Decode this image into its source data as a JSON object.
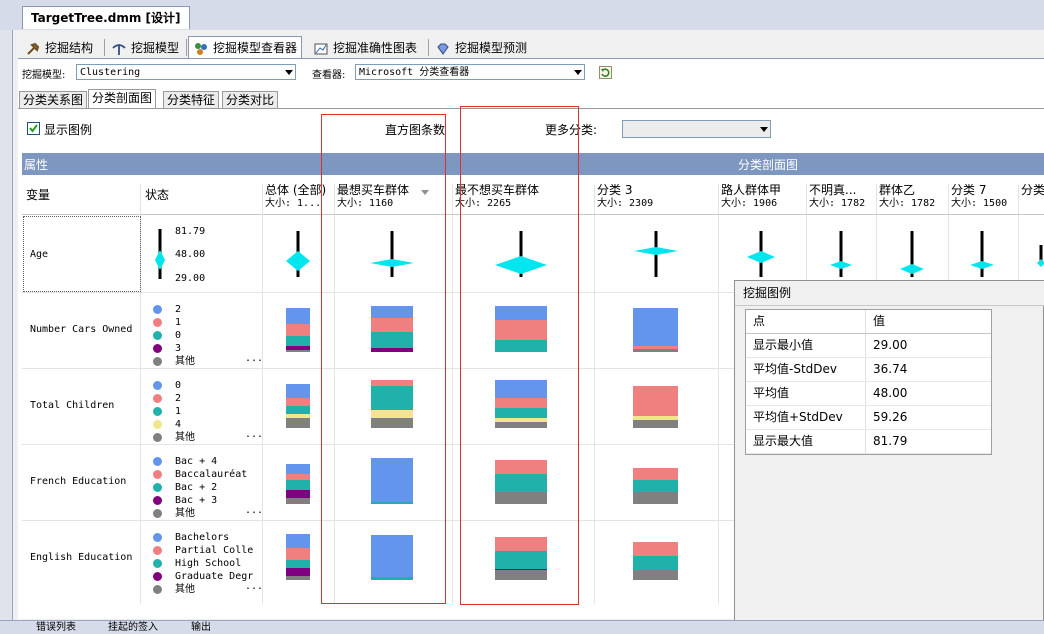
{
  "doc_tab": "TargetTree.dmm [设计]",
  "designer_tabs": [
    "挖掘结构",
    "挖掘模型",
    "挖掘模型查看器",
    "挖掘准确性图表",
    "挖掘模型预测"
  ],
  "model_label": "挖掘模型:",
  "model_value": "Clustering",
  "viewer_label": "查看器:",
  "viewer_value": "Microsoft 分类查看器",
  "view_tabs": [
    "分类关系图",
    "分类剖面图",
    "分类特征",
    "分类对比"
  ],
  "show_legend": "显示图例",
  "histogram_bars_label": "直方图条数",
  "more_clusters_label": "更多分类:",
  "band_left": "属性",
  "band_right": "分类剖面图",
  "col_variable": "变量",
  "col_state": "状态",
  "clusters": [
    {
      "name": "总体 (全部)",
      "size": "大小: 1..."
    },
    {
      "name": "最想买车群体",
      "size": "大小: 1160"
    },
    {
      "name": "最不想买车群体",
      "size": "大小: 2265"
    },
    {
      "name": "分类 3",
      "size": "大小: 2309"
    },
    {
      "name": "路人群体甲",
      "size": "大小: 1906"
    },
    {
      "name": "不明真...",
      "size": "大小: 1782"
    },
    {
      "name": "群体乙",
      "size": "大小: 1782"
    },
    {
      "name": "分类 7",
      "size": "大小: 1500"
    },
    {
      "name": "分类",
      "size": ""
    }
  ],
  "rows": [
    {
      "variable": "Age",
      "age_labels": [
        "81.79",
        "48.00",
        "29.00"
      ]
    },
    {
      "variable": "Number Cars Owned",
      "states": [
        "2",
        "1",
        "0",
        "3",
        "其他"
      ]
    },
    {
      "variable": "Total Children",
      "states": [
        "0",
        "2",
        "1",
        "4",
        "其他"
      ]
    },
    {
      "variable": "French Education",
      "states": [
        "Bac + 4",
        "Baccalauréat",
        "Bac + 2",
        "Bac + 3",
        "其他"
      ]
    },
    {
      "variable": "English Education",
      "states": [
        "Bachelors",
        "Partial Colle",
        "High School",
        "Graduate Degr",
        "其他"
      ]
    }
  ],
  "ellipsis": "...",
  "legend": {
    "title": "挖掘图例",
    "col_point": "点",
    "col_value": "值",
    "rows": [
      {
        "label": "显示最小值",
        "value": "29.00"
      },
      {
        "label": "平均值-StdDev",
        "value": "36.74"
      },
      {
        "label": "平均值",
        "value": "48.00"
      },
      {
        "label": "平均值+StdDev",
        "value": "59.26"
      },
      {
        "label": "显示最大值",
        "value": "81.79"
      }
    ]
  },
  "bottom_tabs": [
    "错误列表",
    "挂起的签入",
    "输出"
  ],
  "colors": {
    "blue": "#6495ed",
    "salmon": "#f08080",
    "teal": "#20b2aa",
    "purple": "#800080",
    "yellow": "#f0e68c",
    "gray": "#808080",
    "cyan": "#00e5ee",
    "band": "#7d97c0",
    "highlight": "#e0302a"
  }
}
